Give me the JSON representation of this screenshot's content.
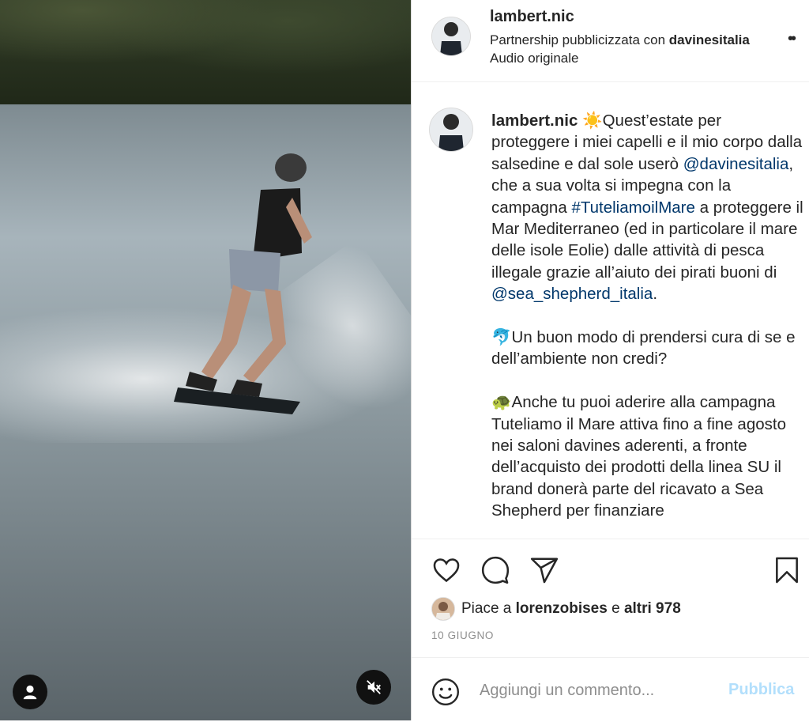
{
  "post": {
    "username": "lambert.nic",
    "partnership_prefix": "Partnership pubblicizzata con ",
    "partner": "davinesitalia",
    "more": "••",
    "audio": "Audio originale"
  },
  "caption": {
    "username": "lambert.nic",
    "sun_emoji": "☀️",
    "text1": "Quest’estate per proteggere i miei capelli e il mio corpo dalla salsedine e dal sole userò ",
    "mention1": "@davinesitalia",
    "text2": ", che a sua volta si impegna con la campagna ",
    "hashtag": "#TuteliamoilMare",
    "text3": " a proteggere il Mar Mediterraneo (ed in particolare il mare delle isole Eolie) dalle attività di pesca illegale grazie all’aiuto dei pirati buoni di ",
    "mention2": "@sea_shepherd_italia",
    "text4": ".",
    "dolphin_emoji": "🐬",
    "para2": "Un buon modo di prendersi cura di se e dell’ambiente non credi?",
    "turtle_emoji": "🐢",
    "para3": "Anche tu puoi aderire alla campagna Tuteliamo il Mare attiva fino a fine agosto nei saloni davines aderenti, a fronte dell’acquisto dei prodotti della linea SU il brand donerà parte del ricavato a Sea Shepherd per finanziare"
  },
  "likes": {
    "prefix": "Piace a ",
    "user": "lorenzobises",
    "middle": " e ",
    "others": "altri 978"
  },
  "date": "10 GIUGNO",
  "comment": {
    "placeholder": "Aggiungi un commento...",
    "publish_label": "Pubblica"
  },
  "icons": {
    "like": "heart-icon",
    "comment": "comment-icon",
    "share": "paper-plane-icon",
    "save": "bookmark-icon",
    "emoji": "emoji-icon",
    "user_tag": "user-icon",
    "mute": "speaker-muted-icon"
  },
  "colors": {
    "link": "#00376b",
    "publish_disabled": "#b2dffc",
    "meta_text": "#8e8e8e"
  }
}
